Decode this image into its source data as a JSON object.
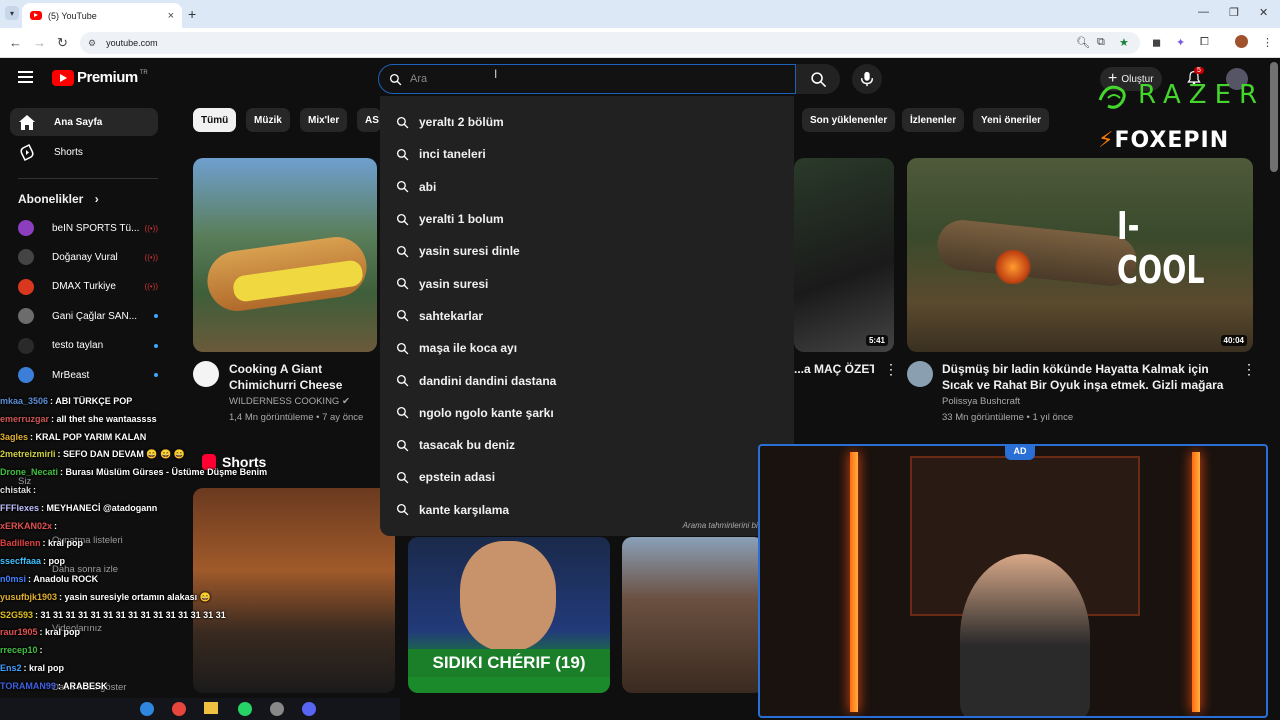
{
  "browser": {
    "tab_title": "(5) YouTube",
    "tab_close": "×",
    "new_tab": "+",
    "url": "youtube.com",
    "window": {
      "minimize": "—",
      "restore": "❐",
      "close": "✕"
    }
  },
  "header": {
    "brand": "Premium",
    "brand_suffix": "TR",
    "search_placeholder": "Ara",
    "create_label": "Oluştur",
    "notif_count": "5"
  },
  "sidebar": {
    "items": [
      {
        "label": "Ana Sayfa"
      },
      {
        "label": "Shorts"
      }
    ],
    "subscriptions_title": "Abonelikler",
    "subscriptions": [
      {
        "name": "beIN SPORTS Tü...",
        "color": "#8b3fbf",
        "status": "live"
      },
      {
        "name": "Doğanay Vural",
        "color": "#444444",
        "status": "live"
      },
      {
        "name": "DMAX Turkiye",
        "color": "#d9381e",
        "status": "live"
      },
      {
        "name": "Gani Çağlar SAN...",
        "color": "#6c6c6c",
        "status": "new"
      },
      {
        "name": "testo taylan",
        "color": "#2a2a2a",
        "status": "new"
      },
      {
        "name": "MrBeast",
        "color": "#3b7fd9",
        "status": "new"
      }
    ],
    "ghost_items": [
      "Siz",
      "Oynatma listeleri",
      "Daha sonra izle",
      "Videolarınız",
      "Daha fazla göster"
    ]
  },
  "chips": [
    "Tümü",
    "Müzik",
    "Mix'ler",
    "AS",
    "Son yüklenenler",
    "İzlenenler",
    "Yeni öneriler"
  ],
  "videos": [
    {
      "title": "Cooking A Giant Chimichurri Cheese",
      "channel": "WILDERNESS COOKING",
      "meta": "1,4 Mn görüntüleme • 7 ay önce"
    },
    {
      "title": "...a MAÇ ÖZETİ |",
      "duration": "5:41"
    },
    {
      "title": "Düşmüş bir ladin kökünde Hayatta Kalmak için Sıcak ve Rahat Bir Oyuk inşa etmek. Gizli mağara",
      "channel": "Polissya Bushcraft",
      "meta": "33 Mn görüntüleme • 1 yıl önce",
      "duration": "40:04"
    }
  ],
  "search_suggestions": [
    "yeraltı 2 bölüm",
    "inci taneleri",
    "abi",
    "yeralti 1 bolum",
    "yasin suresi dinle",
    "yasin suresi",
    "sahtekarlar",
    "maşa ile koca ayı",
    "dandini dandini dastana",
    "ngolo ngolo kante şarkı",
    "tasacak bu deniz",
    "epstein adasi",
    "kante karşılama"
  ],
  "report_text": "Arama tahminlerini bild",
  "shorts_title": "Shorts",
  "shorts": [
    {
      "caption": "SIDIKI CHÉRIF (19)"
    }
  ],
  "ads": {
    "razer": "RAZER",
    "foxepin": "FOXEPIN",
    "icool": "I-COOL"
  },
  "chat": [
    {
      "user": "mkaa_3506",
      "text": "ABI TÜRKÇE POP",
      "color": "#5b8fd6"
    },
    {
      "user": "emerruzgar",
      "text": "all thet she wantaassss",
      "color": "#d05555"
    },
    {
      "user": "3agles",
      "text": "KRAL POP YARIM KALAN",
      "color": "#e0b030"
    },
    {
      "user": "2metreizmirli",
      "text": "SEFO DAN DEVAM 😄 😄 😄",
      "color": "#d0d040"
    },
    {
      "user": "Drone_Necati",
      "text": "Burası Müslüm Gürses - Üstüme Düşme Benim",
      "color": "#40c040"
    },
    {
      "user": "chistak",
      "text": "",
      "color": "#dddddd"
    },
    {
      "user": "FFFlexes",
      "text": "MEYHANECİ @atadogann",
      "color": "#c0c0ff"
    },
    {
      "user": "xERKAN02x",
      "text": "",
      "color": "#e05050"
    },
    {
      "user": "Badillenn",
      "text": "kral pop",
      "color": "#e04040"
    },
    {
      "user": "ssecffaaa",
      "text": "pop",
      "color": "#40c0ff"
    },
    {
      "user": "n0msi",
      "text": "Anadolu ROCK",
      "color": "#4080ff"
    },
    {
      "user": "yusufbjk1903",
      "text": "yasin suresiyle ortamın alakası 😄",
      "color": "#e0b030"
    },
    {
      "user": "S2G593",
      "text": "31 31 31 31 31 31 31 31 31 31 31 31 31 31 31",
      "color": "#e0c020"
    },
    {
      "user": "raur1905",
      "text": "kral pop",
      "color": "#e05050"
    },
    {
      "user": "rrecep10",
      "text": "",
      "color": "#40c040"
    },
    {
      "user": "Ens2",
      "text": "kral pop",
      "color": "#40a0ff"
    },
    {
      "user": "TORAMAN99",
      "text": "ARABESK",
      "color": "#4060e0"
    }
  ]
}
